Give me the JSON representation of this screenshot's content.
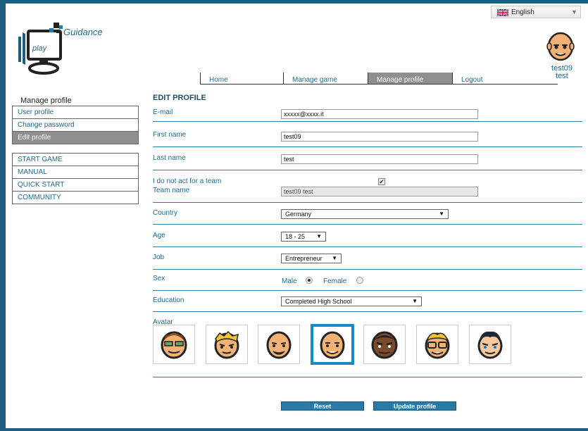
{
  "language": {
    "selected": "English"
  },
  "logo": {
    "text": "Guidance",
    "small": "play"
  },
  "user": {
    "username": "test09",
    "display": "test"
  },
  "nav": [
    {
      "label": "Home"
    },
    {
      "label": "Manage game"
    },
    {
      "label": "Manage profile",
      "active": true
    },
    {
      "label": "Logout"
    }
  ],
  "sidebar": {
    "title": "Manage profile",
    "profile_items": [
      {
        "label": "User profile"
      },
      {
        "label": "Change password"
      },
      {
        "label": "Edit profile",
        "active": true
      }
    ],
    "game_items": [
      {
        "label": "START GAME"
      },
      {
        "label": "MANUAL"
      },
      {
        "label": "QUICK START"
      },
      {
        "label": "COMMUNITY"
      }
    ]
  },
  "form": {
    "title": "EDIT PROFILE",
    "email": {
      "label": "E-mail",
      "value": "xxxxx@xxxx.it"
    },
    "first_name": {
      "label": "First name",
      "value": "test09"
    },
    "last_name": {
      "label": "Last name",
      "value": "test"
    },
    "no_team": {
      "label": "I do not act for a team",
      "checked": true
    },
    "team_name": {
      "label": "Team name",
      "value": "test09 test"
    },
    "country": {
      "label": "Country",
      "value": "Germany"
    },
    "age": {
      "label": "Age",
      "value": "18 - 25"
    },
    "job": {
      "label": "Job",
      "value": "Entrepreneur"
    },
    "sex": {
      "label": "Sex",
      "male": "Male",
      "female": "Female",
      "selected": "Male"
    },
    "education": {
      "label": "Education",
      "value": "Completed High School"
    },
    "avatar": {
      "label": "Avatar",
      "selected_index": 3
    }
  },
  "buttons": {
    "reset": "Reset",
    "update": "Update profile"
  },
  "colors": {
    "accent": "#1f6a8c",
    "active_tab": "#8f8f8f",
    "button": "#2a7aa8",
    "border": "#1f5d80"
  }
}
